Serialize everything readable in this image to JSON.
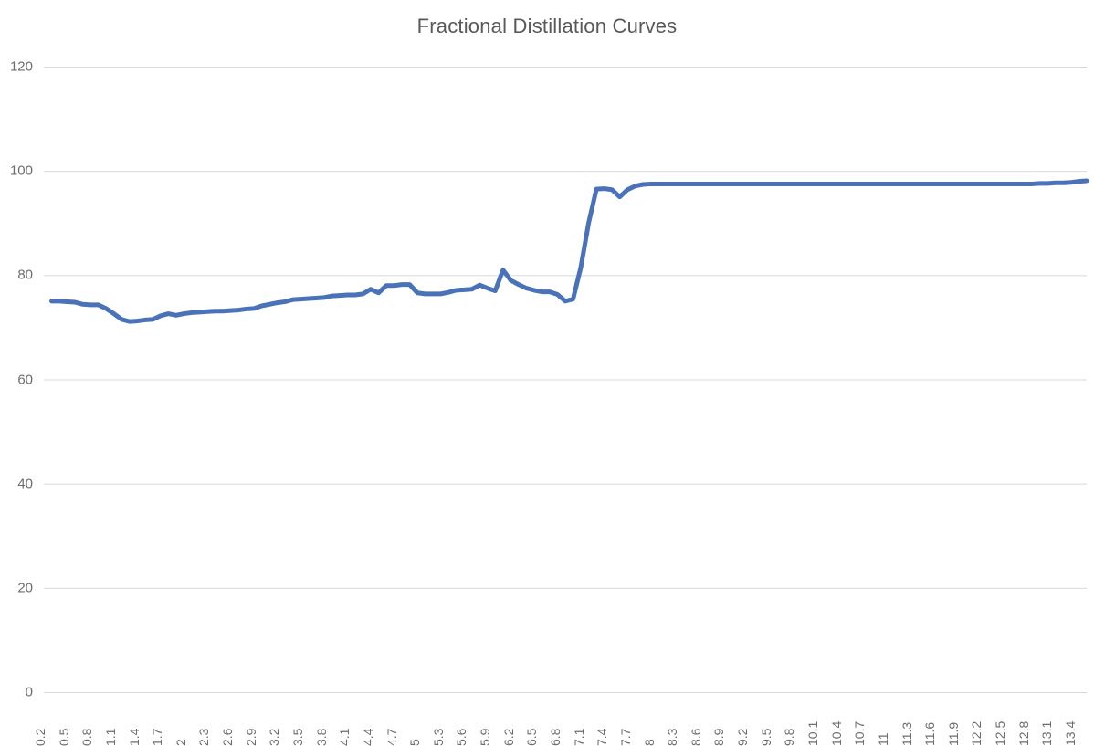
{
  "chart_data": {
    "type": "line",
    "title": "Fractional Distillation Curves",
    "xlabel": "",
    "ylabel": "",
    "ylim": [
      0,
      120
    ],
    "y_ticks": [
      0,
      20,
      40,
      60,
      80,
      100,
      120
    ],
    "xlim": [
      0.1,
      13.5
    ],
    "grid": "horizontal",
    "legend": "none",
    "line_color": "#4a72b8",
    "x_tick_labels": [
      "0.2",
      "0.5",
      "0.8",
      "1.1",
      "1.4",
      "1.7",
      "2",
      "2.3",
      "2.6",
      "2.9",
      "3.2",
      "3.5",
      "3.8",
      "4.1",
      "4.4",
      "4.7",
      "5",
      "5.3",
      "5.6",
      "5.9",
      "6.2",
      "6.5",
      "6.8",
      "7.1",
      "7.4",
      "7.7",
      "8",
      "8.3",
      "8.6",
      "8.9",
      "9.2",
      "9.5",
      "9.8",
      "10.1",
      "10.4",
      "10.7",
      "11",
      "11.3",
      "11.6",
      "11.9",
      "12.2",
      "12.5",
      "12.8",
      "13.1",
      "13.4"
    ],
    "x_tick_step": 0.3,
    "x_data_step": 0.1,
    "series": [
      {
        "name": "Fractional Distillation",
        "x": [
          0.2,
          0.3,
          0.4,
          0.5,
          0.6,
          0.7,
          0.8,
          0.9,
          1.0,
          1.1,
          1.2,
          1.3,
          1.4,
          1.5,
          1.6,
          1.7,
          1.8,
          1.9,
          2.0,
          2.1,
          2.2,
          2.3,
          2.4,
          2.5,
          2.6,
          2.7,
          2.8,
          2.9,
          3.0,
          3.1,
          3.2,
          3.3,
          3.4,
          3.5,
          3.6,
          3.7,
          3.8,
          3.9,
          4.0,
          4.1,
          4.2,
          4.3,
          4.4,
          4.5,
          4.6,
          4.7,
          4.8,
          4.9,
          5.0,
          5.1,
          5.2,
          5.3,
          5.4,
          5.5,
          5.6,
          5.7,
          5.8,
          5.9,
          6.0,
          6.1,
          6.2,
          6.3,
          6.4,
          6.5,
          6.6,
          6.7,
          6.8,
          6.9,
          7.0,
          7.1,
          7.2,
          7.3,
          7.4,
          7.5,
          7.6,
          7.7,
          7.8,
          7.9,
          8.0,
          8.1,
          8.2,
          8.3,
          8.4,
          8.5,
          8.6,
          8.7,
          8.8,
          8.9,
          9.0,
          9.1,
          9.2,
          9.3,
          9.4,
          9.5,
          9.6,
          9.7,
          9.8,
          9.9,
          10.0,
          10.1,
          10.2,
          10.3,
          10.4,
          10.5,
          10.6,
          10.7,
          10.8,
          10.9,
          11.0,
          11.1,
          11.2,
          11.3,
          11.4,
          11.5,
          11.6,
          11.7,
          11.8,
          11.9,
          12.0,
          12.1,
          12.2,
          12.3,
          12.4,
          12.5,
          12.6,
          12.7,
          12.8,
          12.9,
          13.0,
          13.1,
          13.2,
          13.3,
          13.4,
          13.5
        ],
        "values": [
          75.0,
          75.0,
          74.9,
          74.8,
          74.4,
          74.3,
          74.3,
          73.6,
          72.6,
          71.5,
          71.1,
          71.2,
          71.4,
          71.5,
          72.2,
          72.6,
          72.3,
          72.6,
          72.8,
          72.9,
          73.0,
          73.1,
          73.1,
          73.2,
          73.3,
          73.5,
          73.6,
          74.1,
          74.4,
          74.7,
          74.9,
          75.3,
          75.4,
          75.5,
          75.6,
          75.7,
          76.0,
          76.1,
          76.2,
          76.2,
          76.4,
          77.3,
          76.6,
          78.0,
          78.0,
          78.2,
          78.2,
          76.6,
          76.4,
          76.4,
          76.4,
          76.7,
          77.1,
          77.2,
          77.3,
          78.1,
          77.5,
          77.0,
          81.0,
          79.0,
          78.2,
          77.5,
          77.1,
          76.8,
          76.8,
          76.3,
          75.0,
          75.4,
          81.5,
          90.0,
          96.5,
          96.6,
          96.4,
          95.0,
          96.4,
          97.1,
          97.4,
          97.5,
          97.5,
          97.5,
          97.5,
          97.5,
          97.5,
          97.5,
          97.5,
          97.5,
          97.5,
          97.5,
          97.5,
          97.5,
          97.5,
          97.5,
          97.5,
          97.5,
          97.5,
          97.5,
          97.5,
          97.5,
          97.5,
          97.5,
          97.5,
          97.5,
          97.5,
          97.5,
          97.5,
          97.5,
          97.5,
          97.5,
          97.5,
          97.5,
          97.5,
          97.5,
          97.5,
          97.5,
          97.5,
          97.5,
          97.5,
          97.5,
          97.5,
          97.5,
          97.5,
          97.5,
          97.5,
          97.5,
          97.5,
          97.5,
          97.5,
          97.6,
          97.6,
          97.7,
          97.7,
          97.8,
          98.0,
          98.1
        ]
      }
    ]
  }
}
